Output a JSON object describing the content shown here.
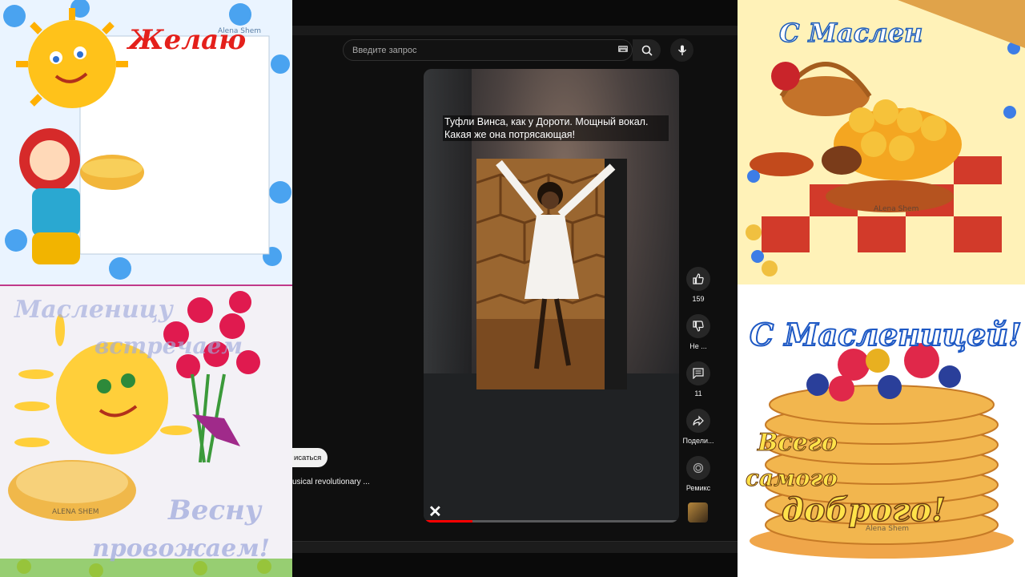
{
  "cards": {
    "top_left_title": "Желаю",
    "top_left_watermark": "Alena Shem",
    "bottom_left_line1": "Масленицу",
    "bottom_left_line2": "встречаем",
    "bottom_left_line3": "Весну",
    "bottom_left_line4": "провожаем!",
    "bottom_left_watermark": "ALENA SHEM",
    "top_right_title": "С Маслен",
    "top_right_watermark": "ALena Shem",
    "bottom_right_title": "С Масленицей!",
    "bottom_right_sub1": "Всего",
    "bottom_right_sub2": "самого",
    "bottom_right_sub3": "доброго!",
    "bottom_right_watermark": "Alena Shem"
  },
  "youtube": {
    "search": {
      "placeholder": "Введите запрос"
    },
    "short": {
      "caption_line1": "Туфли Винса, как у Дороти.  Мощный вокал.",
      "caption_line2": "Какая же она потрясающая!",
      "progress_fraction": 0.19
    },
    "actions": {
      "like_count": "159",
      "dislike_label": "Не ...",
      "comment_count": "11",
      "share_label": "Подели...",
      "remix_label": "Ремикс"
    },
    "subscribe_label": "исаться",
    "channel_title": "usical revolutionary ..."
  },
  "colors": {
    "accent": "#ff0000",
    "bg": "#0f0f0f"
  }
}
